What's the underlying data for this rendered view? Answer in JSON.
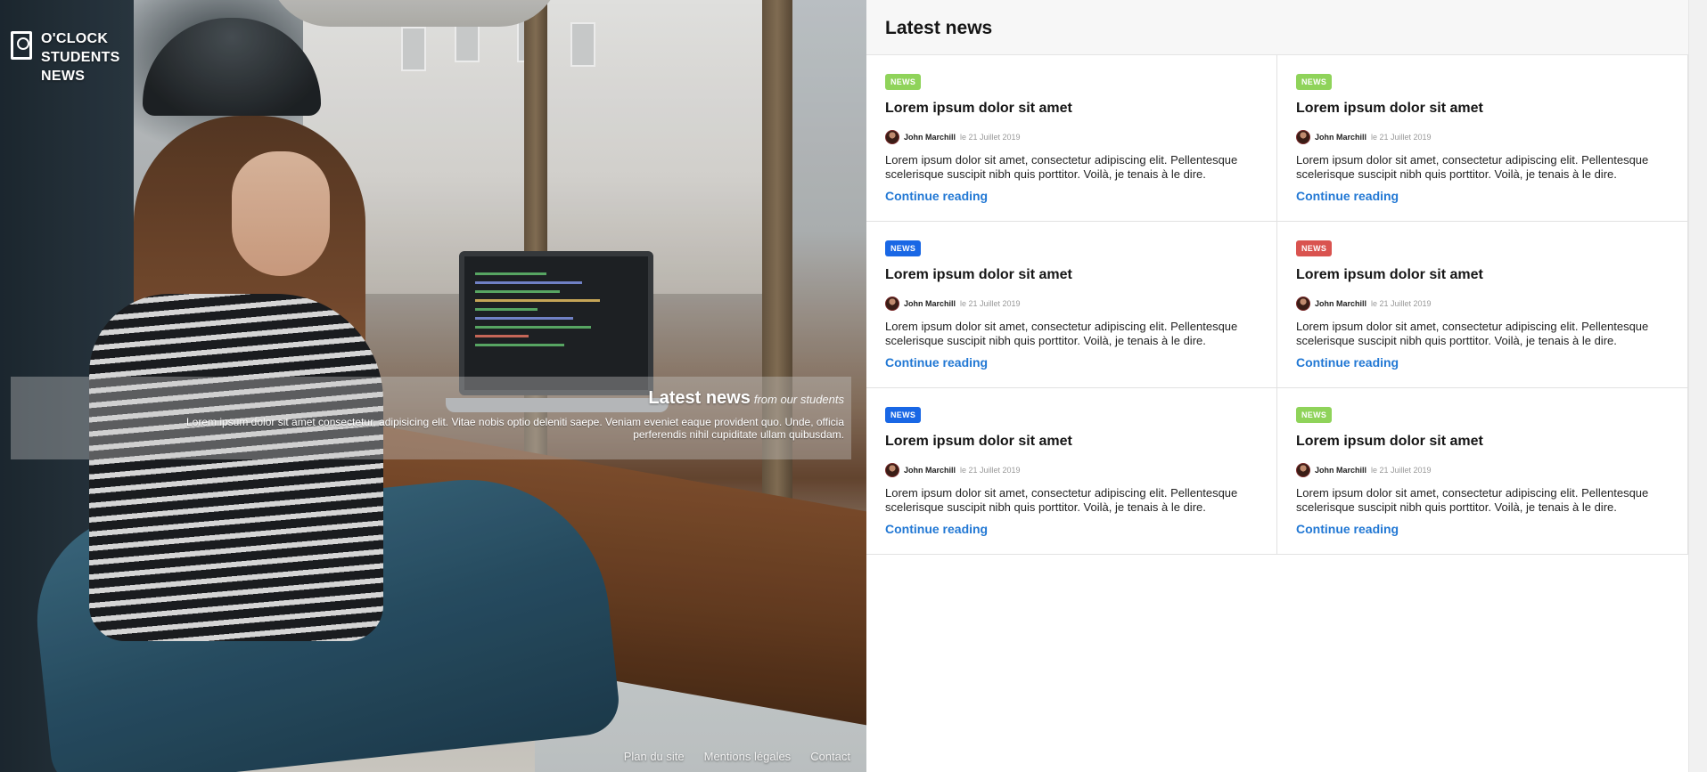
{
  "brand": {
    "line1": "O'CLOCK",
    "line2": "STUDENTS",
    "line3": "NEWS"
  },
  "hero": {
    "title": "Latest news",
    "subtitle": "from our students",
    "text": "Lorem ipsum dolor sit amet consectetur, adipisicing elit. Vitae nobis optio deleniti saepe. Veniam eveniet eaque provident quo. Unde, officia perferendis nihil cupiditate ullam quibusdam."
  },
  "footer": {
    "links": [
      "Plan du site",
      "Mentions légales",
      "Contact"
    ]
  },
  "panel": {
    "title": "Latest news"
  },
  "colors": {
    "green": "#8fd35a",
    "blue": "#1967e5",
    "red": "#d9534f",
    "link": "#2278d4"
  },
  "articles": [
    {
      "badge": "NEWS",
      "badge_color": "green",
      "title": "Lorem ipsum dolor sit amet",
      "author": "John Marchill",
      "date": "le 21 Juillet 2019",
      "excerpt": "Lorem ipsum dolor sit amet, consectetur adipiscing elit. Pellentesque scelerisque suscipit nibh quis porttitor. Voilà, je tenais à le dire.",
      "link": "Continue reading"
    },
    {
      "badge": "NEWS",
      "badge_color": "green",
      "title": "Lorem ipsum dolor sit amet",
      "author": "John Marchill",
      "date": "le 21 Juillet 2019",
      "excerpt": "Lorem ipsum dolor sit amet, consectetur adipiscing elit. Pellentesque scelerisque suscipit nibh quis porttitor. Voilà, je tenais à le dire.",
      "link": "Continue reading"
    },
    {
      "badge": "NEWS",
      "badge_color": "blue",
      "title": "Lorem ipsum dolor sit amet",
      "author": "John Marchill",
      "date": "le 21 Juillet 2019",
      "excerpt": "Lorem ipsum dolor sit amet, consectetur adipiscing elit. Pellentesque scelerisque suscipit nibh quis porttitor. Voilà, je tenais à le dire.",
      "link": "Continue reading"
    },
    {
      "badge": "NEWS",
      "badge_color": "red",
      "title": "Lorem ipsum dolor sit amet",
      "author": "John Marchill",
      "date": "le 21 Juillet 2019",
      "excerpt": "Lorem ipsum dolor sit amet, consectetur adipiscing elit. Pellentesque scelerisque suscipit nibh quis porttitor. Voilà, je tenais à le dire.",
      "link": "Continue reading"
    },
    {
      "badge": "NEWS",
      "badge_color": "blue",
      "title": "Lorem ipsum dolor sit amet",
      "author": "John Marchill",
      "date": "le 21 Juillet 2019",
      "excerpt": "Lorem ipsum dolor sit amet, consectetur adipiscing elit. Pellentesque scelerisque suscipit nibh quis porttitor. Voilà, je tenais à le dire.",
      "link": "Continue reading"
    },
    {
      "badge": "NEWS",
      "badge_color": "green",
      "title": "Lorem ipsum dolor sit amet",
      "author": "John Marchill",
      "date": "le 21 Juillet 2019",
      "excerpt": "Lorem ipsum dolor sit amet, consectetur adipiscing elit. Pellentesque scelerisque suscipit nibh quis porttitor. Voilà, je tenais à le dire.",
      "link": "Continue reading"
    }
  ]
}
